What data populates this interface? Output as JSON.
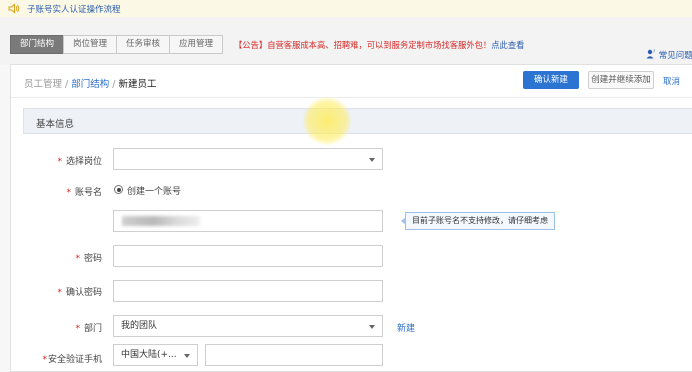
{
  "notice_bar": {
    "text": "子账号实人认证操作流程"
  },
  "tabs": [
    {
      "label": "部门结构",
      "active": true
    },
    {
      "label": "岗位管理",
      "active": false
    },
    {
      "label": "任务审核",
      "active": false
    },
    {
      "label": "应用管理",
      "active": false
    }
  ],
  "announcement": {
    "text": "【公告】自营客服成本高、招聘难，可以到服务定制市场找客服外包！",
    "link": "点此查看"
  },
  "faq": {
    "label": "常见问题"
  },
  "breadcrumb": {
    "root": "员工管理",
    "sep1": " / ",
    "parent": "部门结构",
    "sep2": " / ",
    "current": "新建员工"
  },
  "actions": {
    "confirm": "确认新建",
    "create_continue": "创建并继续添加",
    "cancel": "取消"
  },
  "section": {
    "title": "基本信息"
  },
  "form": {
    "position": {
      "label": "选择岗位",
      "value": ""
    },
    "account": {
      "label": "账号名",
      "radio_label": "创建一个账号",
      "tip": "目前子账号名不支持修改，请仔细考虑"
    },
    "password": {
      "label": "密码"
    },
    "confirm_password": {
      "label": "确认密码"
    },
    "department": {
      "label": "部门",
      "value": "我的团队",
      "new_link": "新建"
    },
    "phone": {
      "label": "安全验证手机",
      "country": "中国大陆(+..."
    }
  },
  "colors": {
    "primary": "#2b74d1",
    "required": "#e02020",
    "link": "#2a6fc9",
    "announce": "#d42a2a"
  }
}
